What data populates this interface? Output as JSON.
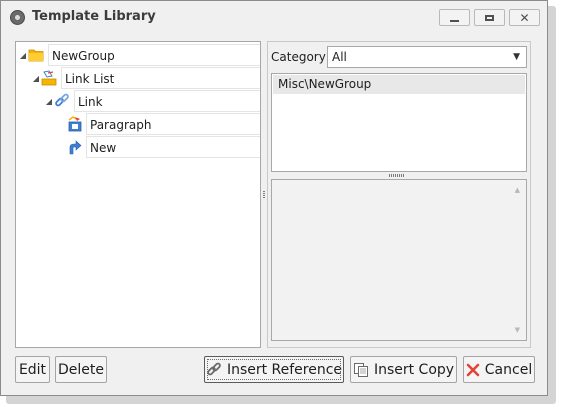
{
  "window": {
    "title": "Template Library",
    "minimize_icon": "minimize-icon",
    "maximize_icon": "maximize-icon",
    "close_icon": "close-icon"
  },
  "tree": {
    "nodes": [
      {
        "label": "NewGroup",
        "icon": "folder-icon",
        "expanded": true
      },
      {
        "label": "Link List",
        "icon": "link-list-icon",
        "expanded": true
      },
      {
        "label": "Link",
        "icon": "link-icon",
        "expanded": true
      },
      {
        "label": "Paragraph",
        "icon": "paragraph-icon"
      },
      {
        "label": "New",
        "icon": "new-arrow-icon"
      }
    ]
  },
  "category": {
    "label": "Category",
    "selected": "All"
  },
  "category_list": {
    "items": [
      "Misc\\NewGroup"
    ]
  },
  "buttons": {
    "edit": "Edit",
    "delete": "Delete",
    "insert_reference": "Insert Reference",
    "insert_copy": "Insert Copy",
    "cancel": "Cancel"
  },
  "colors": {
    "folder": "#f5b400",
    "link": "#3c7fd6",
    "cancel_icon": "#e0443a"
  }
}
